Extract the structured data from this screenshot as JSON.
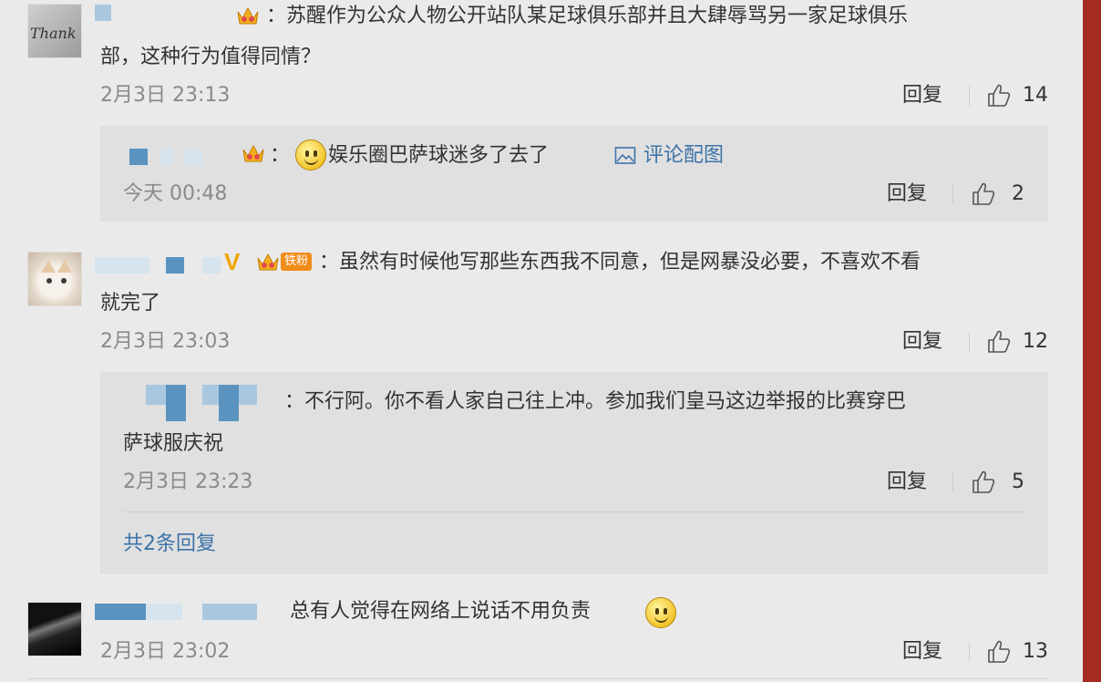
{
  "comments": [
    {
      "text_line1": "：苏醒作为公众人物公开站队某足球俱乐部并且大肆辱骂另一家足球俱乐",
      "text_line2": "部，这种行为值得同情？",
      "time": "2月3日 23:13",
      "reply_label": "回复",
      "likes": "14",
      "avatar_text": "Thank",
      "sub_reply": {
        "text": "娱乐圈巴萨球迷多了去了",
        "image_link": "评论配图",
        "time": "今天 00:48",
        "reply_label": "回复",
        "likes": "2"
      }
    },
    {
      "text_line1": "：虽然有时候他写那些东西我不同意，但是网暴没必要，不喜欢不看",
      "text_line2": "就完了",
      "time": "2月3日 23:03",
      "reply_label": "回复",
      "likes": "12",
      "vip_badge": "V",
      "fan_badge": "铁粉",
      "sub_reply": {
        "text_line1": "：不行阿。你不看人家自己往上冲。参加我们皇马这边举报的比赛穿巴",
        "text_line2": "萨球服庆祝",
        "time": "2月3日 23:23",
        "reply_label": "回复",
        "likes": "5"
      },
      "more_replies": "共2条回复"
    },
    {
      "text": "总有人觉得在网络上说话不用负责",
      "time": "2月3日 23:02",
      "reply_label": "回复",
      "likes": "13"
    }
  ],
  "colors": {
    "background": "#eaeaea",
    "accent_bar": "#a52a22",
    "link": "#3d73a8",
    "timestamp": "#8a8a8a"
  },
  "icons": [
    "crown-icon",
    "smile-emoji-icon",
    "thumbs-up-icon",
    "image-icon",
    "vip-badge-icon",
    "fan-badge-icon"
  ]
}
